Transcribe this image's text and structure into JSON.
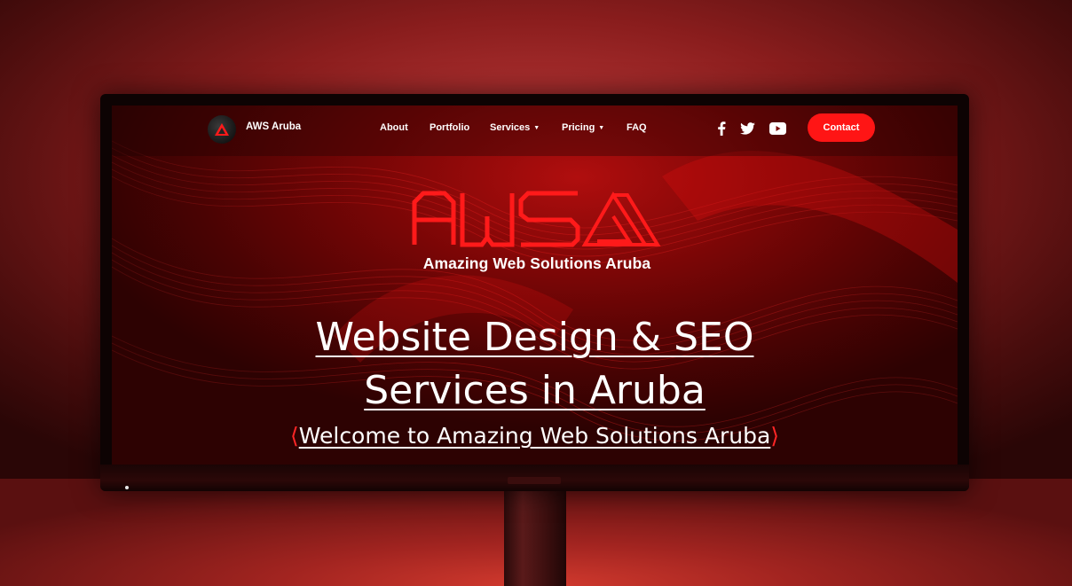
{
  "navbar": {
    "brand": "AWS Aruba",
    "items": [
      {
        "label": "About",
        "caret": false
      },
      {
        "label": "Portfolio",
        "caret": false
      },
      {
        "label": "Services",
        "caret": true
      },
      {
        "label": "Pricing",
        "caret": true
      },
      {
        "label": "FAQ",
        "caret": false
      }
    ],
    "social": [
      "facebook-icon",
      "twitter-icon",
      "youtube-icon"
    ],
    "contact_label": "Contact"
  },
  "logo": {
    "wordmark": "AWS",
    "subtitle": "Amazing Web Solutions Aruba"
  },
  "hero": {
    "title_line1": "Website Design & SEO",
    "title_line2": "Services in Aruba",
    "welcome_open": "⟨",
    "welcome": "Welcome to Amazing Web Solutions Aruba",
    "welcome_close": "⟩"
  },
  "colors": {
    "accent": "#ff1515",
    "background": "#7a0606"
  }
}
